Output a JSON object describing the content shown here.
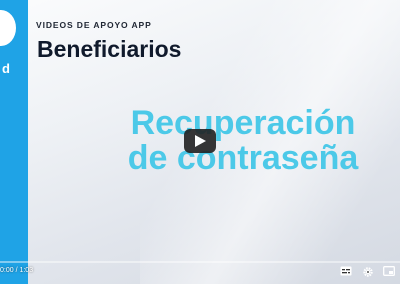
{
  "video": {
    "eyebrow": "VIDEOS DE APOYO APP",
    "title": "Beneficiarios",
    "headline_line1": "Recuperación",
    "headline_line2": "de contraseña",
    "logo_partial": "d"
  },
  "player": {
    "current_time": "0:00",
    "separator": " / ",
    "duration": "1:03",
    "progress_fraction": 0.0,
    "buttons": [
      "subtitles-icon",
      "settings-icon",
      "miniplayer-icon"
    ]
  },
  "colors": {
    "brand_blue": "#1fa3e6",
    "headline_cyan": "#4cc9e8",
    "title_dark": "#101a2c",
    "progress_red": "#ff0000"
  }
}
